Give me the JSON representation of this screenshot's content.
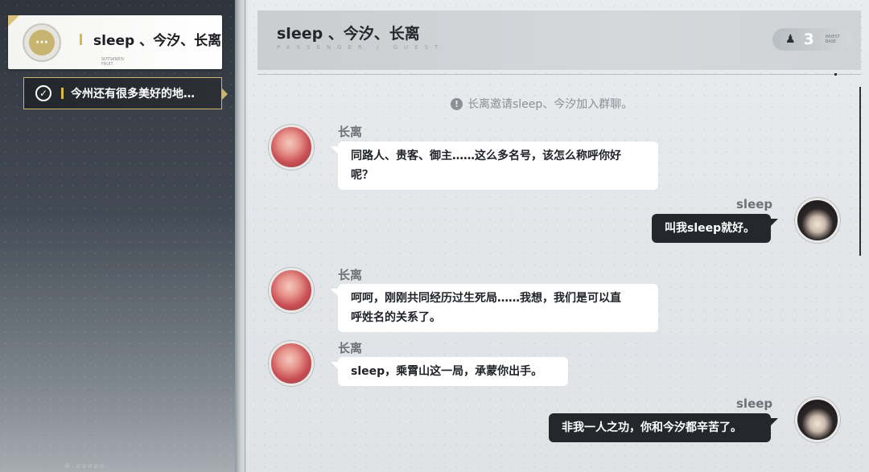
{
  "sidebar": {
    "chat": {
      "title": "sleep 、今汐、长离",
      "icon": "chat-bubble-icon",
      "icon_glyph": "···",
      "subtext": "SOTSKNEIV\nFRUIT"
    },
    "task": {
      "label": "今州还有很多美好的地…",
      "icon": "check-circle-icon",
      "icon_glyph": "✓"
    },
    "footer_mark": "⊗ ⌀⌀⌀⌀⌀"
  },
  "header": {
    "title": "sleep 、今汐、长离",
    "subline": "PASSENGER  /  GUEST",
    "members": {
      "icon": "person-icon",
      "icon_glyph": "♟",
      "count": "3",
      "tag": "INVEST\nBASE"
    }
  },
  "system_message": {
    "icon": "warning-icon",
    "icon_glyph": "!",
    "text": "长离邀请sleep、今汐加入群聊。"
  },
  "messages": [
    {
      "sender": "长离",
      "side": "left",
      "text_line1": "同路人、贵客、御主……这么多名号，该怎么称呼你好",
      "text_line2": "呢？"
    },
    {
      "sender": "sleep",
      "side": "right",
      "text_line1": "叫我sleep就好。"
    },
    {
      "sender": "长离",
      "side": "left",
      "text_line1": "呵呵，刚刚共同经历过生死局……我想，我们是可以直",
      "text_line2": "呼姓名的关系了。"
    },
    {
      "sender": "长离",
      "side": "left",
      "text_line1": "sleep，乘霄山这一局，承蒙你出手。"
    },
    {
      "sender": "sleep",
      "side": "right",
      "text_line1": "非我一人之功，你和今汐都辛苦了。"
    }
  ],
  "colors": {
    "accent_gold": "#d9b94a",
    "bubble_dark": "#24282d",
    "bubble_light": "#ffffff"
  }
}
